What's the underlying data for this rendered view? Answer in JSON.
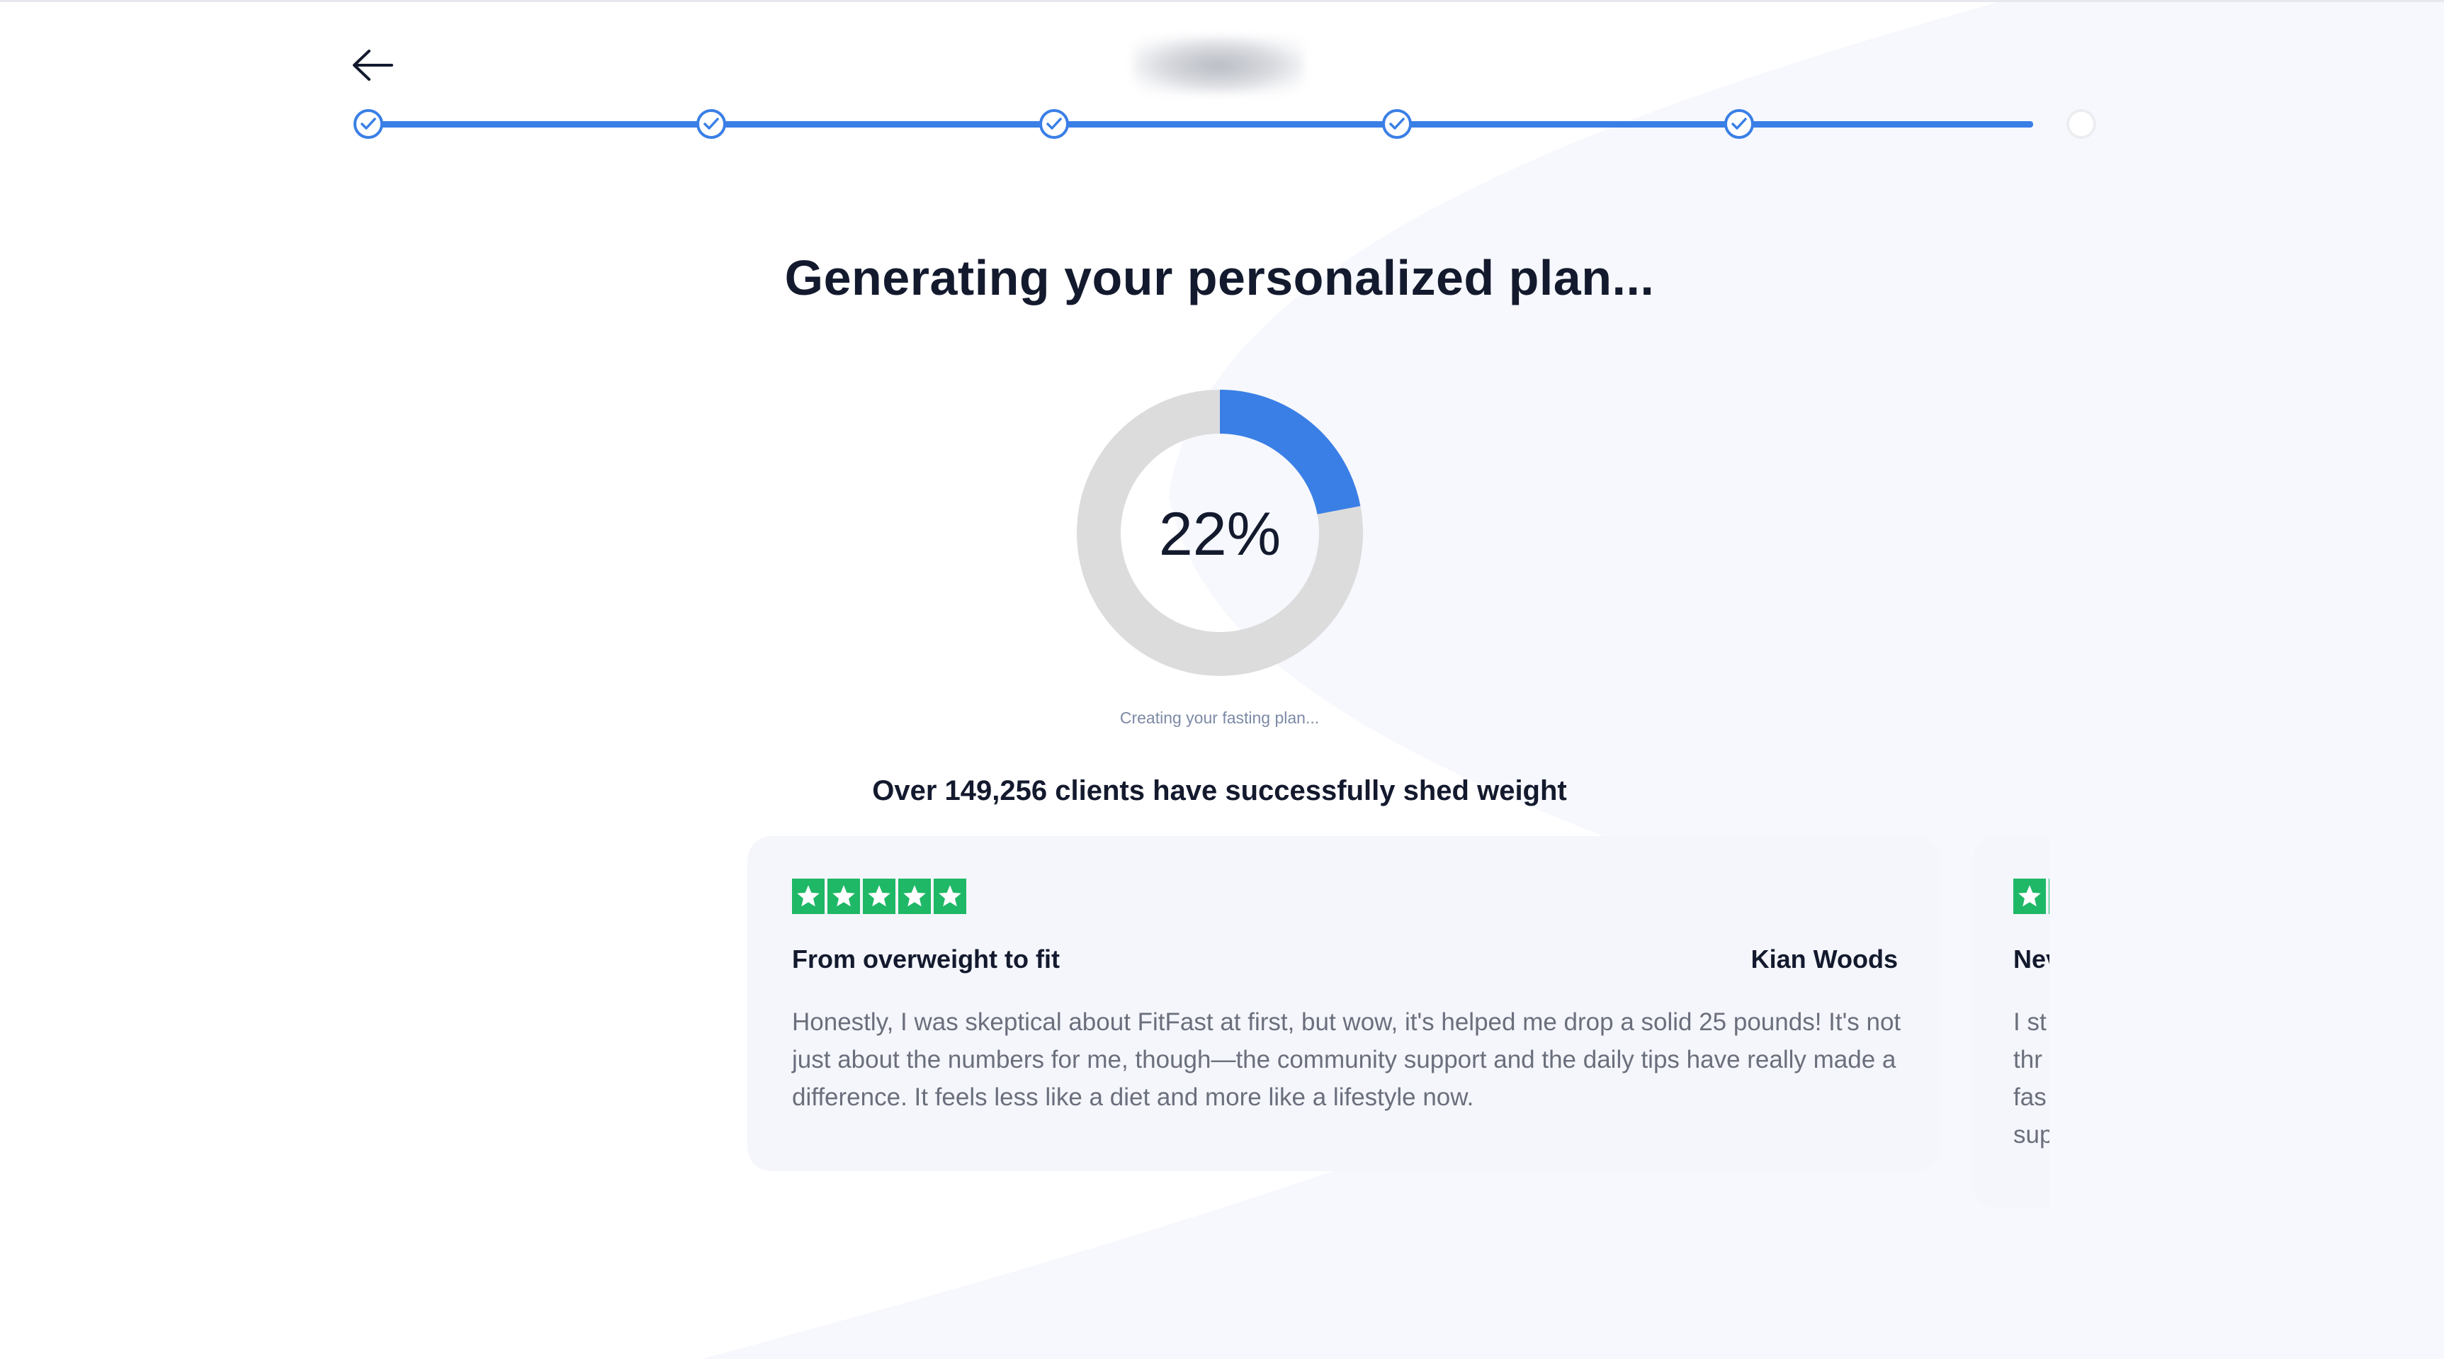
{
  "header": {
    "back_icon": "arrow-left-icon",
    "logo_text": "",
    "brand_color": "#3a7fe6"
  },
  "stepper": {
    "total_steps": 6,
    "completed_steps": 5,
    "check_icon": "check-icon"
  },
  "main": {
    "title": "Generating your personalized plan...",
    "progress_percent": 22,
    "progress_label": "22%",
    "status_text": "Creating your fasting plan...",
    "clients_text": "Over 149,256 clients have successfully shed weight"
  },
  "reviews": [
    {
      "rating": 5,
      "title": "From overweight to fit",
      "author": "Kian Woods",
      "body": "Honestly, I was skeptical about FitFast at first, but wow, it's helped me drop a solid 25 pounds! It's not just about the numbers for me, though—the community support and the daily tips have really made a difference. It feels less like a diet and more like a lifestyle now."
    },
    {
      "rating": 5,
      "title": "Nev",
      "author": "",
      "body_lines": [
        "I st",
        "thr",
        "fas",
        "sup"
      ]
    }
  ],
  "colors": {
    "accent": "#3a7fe6",
    "star_green": "#1fb866",
    "card_bg": "#f4f6fc",
    "donut_track": "#dcdcdc"
  }
}
